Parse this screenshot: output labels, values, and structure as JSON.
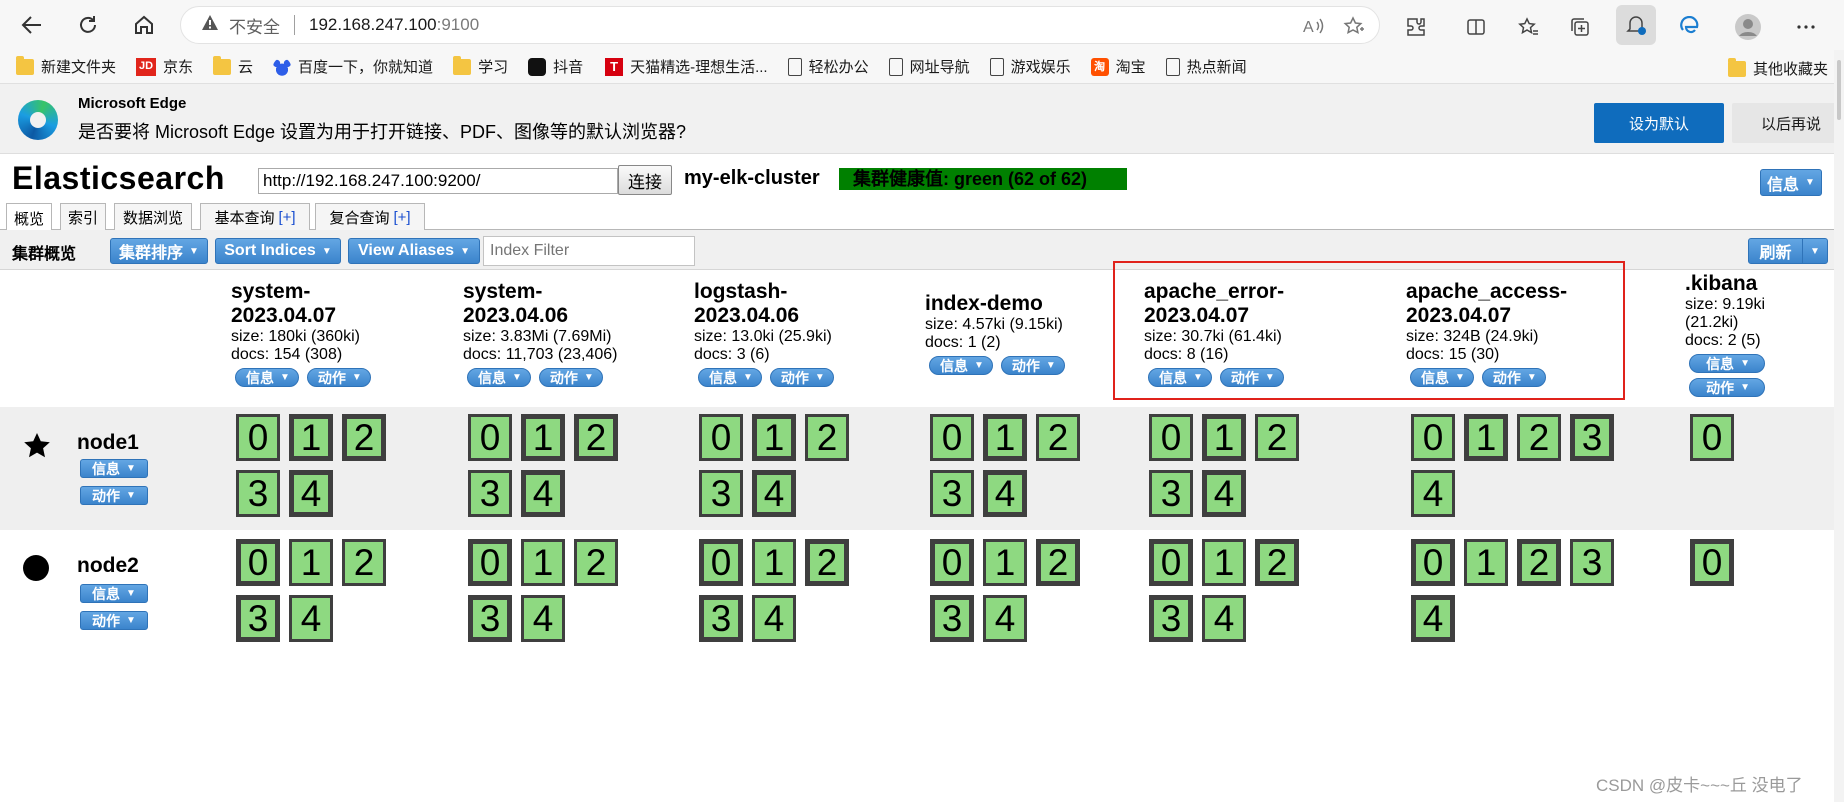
{
  "browser": {
    "insecure_label": "不安全",
    "host": "192.168.247.100",
    "port": ":9100"
  },
  "bookmarks": [
    {
      "label": "新建文件夹",
      "icon": "folder-icon",
      "kind": "folder"
    },
    {
      "label": "京东",
      "icon": "jd-icon",
      "kind": "jd"
    },
    {
      "label": "云",
      "icon": "folder-icon",
      "kind": "folder"
    },
    {
      "label": "百度一下，你就知道",
      "icon": "baidu-paw-icon",
      "kind": "baidu"
    },
    {
      "label": "学习",
      "icon": "folder-icon",
      "kind": "folder"
    },
    {
      "label": "抖音",
      "icon": "douyin-icon",
      "kind": "douyin"
    },
    {
      "label": "天猫精选-理想生活...",
      "icon": "tmall-icon",
      "kind": "tmall"
    },
    {
      "label": "轻松办公",
      "icon": "page-icon",
      "kind": "page"
    },
    {
      "label": "网址导航",
      "icon": "page-icon",
      "kind": "page"
    },
    {
      "label": "游戏娱乐",
      "icon": "page-icon",
      "kind": "page"
    },
    {
      "label": "淘宝",
      "icon": "taobao-icon",
      "kind": "taobao"
    },
    {
      "label": "热点新闻",
      "icon": "page-icon",
      "kind": "page"
    }
  ],
  "bookmarks_other": "其他收藏夹",
  "infobar": {
    "title": "Microsoft Edge",
    "message": "是否要将 Microsoft Edge 设置为用于打开链接、PDF、图像等的默认浏览器?",
    "primary": "设为默认",
    "secondary": "以后再说"
  },
  "es": {
    "title": "Elasticsearch",
    "url_value": "http://192.168.247.100:9200/",
    "connect": "连接",
    "cluster_name": "my-elk-cluster",
    "health": "集群健康值: green (62 of 62)",
    "info_button": "信息",
    "tabs": [
      "概览",
      "索引",
      "数据浏览",
      "基本查询",
      "复合查询"
    ],
    "tab_plus": "[+]",
    "toolbar": {
      "label": "集群概览",
      "sort_button": "集群排序",
      "sort_indices": "Sort Indices",
      "view_aliases": "View Aliases",
      "filter_placeholder": "Index Filter",
      "refresh": "刷新"
    },
    "pill_info": "信息",
    "pill_action": "动作",
    "indices": [
      {
        "name": "system-\n2023.04.07",
        "size": "size: 180ki (360ki)",
        "docs": "docs: 154 (308)"
      },
      {
        "name": "system-\n2023.04.06",
        "size": "size: 3.83Mi (7.69Mi)",
        "docs": "docs: 11,703 (23,406)"
      },
      {
        "name": "logstash-\n2023.04.06",
        "size": "size: 13.0ki (25.9ki)",
        "docs": "docs: 3 (6)"
      },
      {
        "name": "index-demo",
        "size": "size: 4.57ki (9.15ki)",
        "docs": "docs: 1 (2)"
      },
      {
        "name": "apache_error-\n2023.04.07",
        "size": "size: 30.7ki (61.4ki)",
        "docs": "docs: 8 (16)"
      },
      {
        "name": "apache_access-\n2023.04.07",
        "size": "size: 324B (24.9ki)",
        "docs": "docs: 15 (30)"
      },
      {
        "name": ".kibana",
        "size": "size: 9.19ki\n(21.2ki)",
        "docs": "docs: 2 (5)"
      }
    ],
    "nodes": [
      {
        "name": "node1",
        "symbol": "star-icon",
        "shards": [
          [
            "0",
            "1",
            "2",
            "3",
            "4"
          ],
          [
            "0",
            "1",
            "2",
            "3",
            "4"
          ],
          [
            "0",
            "1",
            "2",
            "3",
            "4"
          ],
          [
            "0",
            "1",
            "2",
            "3",
            "4"
          ],
          [
            "0",
            "1",
            "2",
            "3",
            "4"
          ],
          [
            "0",
            "1",
            "2",
            "3",
            "4"
          ],
          [
            "0"
          ]
        ],
        "primary": [
          [
            false,
            true,
            true,
            false,
            true
          ],
          [
            false,
            true,
            true,
            false,
            true
          ],
          [
            false,
            true,
            false,
            false,
            true
          ],
          [
            false,
            true,
            false,
            false,
            true
          ],
          [
            false,
            true,
            false,
            false,
            true
          ],
          [
            false,
            true,
            false,
            true,
            false
          ],
          [
            false
          ]
        ]
      },
      {
        "name": "node2",
        "symbol": "circle-icon",
        "shards": [
          [
            "0",
            "1",
            "2",
            "3",
            "4"
          ],
          [
            "0",
            "1",
            "2",
            "3",
            "4"
          ],
          [
            "0",
            "1",
            "2",
            "3",
            "4"
          ],
          [
            "0",
            "1",
            "2",
            "3",
            "4"
          ],
          [
            "0",
            "1",
            "2",
            "3",
            "4"
          ],
          [
            "0",
            "1",
            "2",
            "3",
            "4"
          ],
          [
            "0"
          ]
        ],
        "primary": [
          [
            true,
            false,
            false,
            true,
            false
          ],
          [
            true,
            false,
            false,
            true,
            false
          ],
          [
            true,
            false,
            true,
            true,
            false
          ],
          [
            true,
            false,
            true,
            true,
            false
          ],
          [
            true,
            false,
            true,
            true,
            false
          ],
          [
            true,
            false,
            true,
            false,
            true
          ],
          [
            true
          ]
        ]
      }
    ]
  },
  "watermark": "CSDN @皮卡~~~丘 没电了",
  "colors": {
    "health_green": "#008000",
    "shard_fill": "#8ed981",
    "highlight_red": "#e0221b",
    "button_blue": "#3b84cc"
  }
}
